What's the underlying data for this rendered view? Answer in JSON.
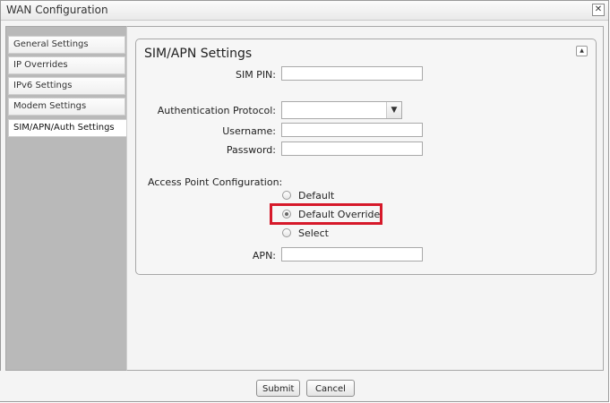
{
  "window": {
    "title": "WAN Configuration",
    "close_glyph": "✕"
  },
  "sidebar": {
    "items": [
      {
        "label": "General Settings"
      },
      {
        "label": "IP Overrides"
      },
      {
        "label": "IPv6 Settings"
      },
      {
        "label": "Modem Settings"
      },
      {
        "label": "SIM/APN/Auth Settings",
        "active": true
      }
    ]
  },
  "panel": {
    "title": "SIM/APN Settings",
    "collapse_glyph": "▲",
    "fields": {
      "sim_pin": {
        "label": "SIM PIN:",
        "value": ""
      },
      "auth_protocol": {
        "label": "Authentication Protocol:",
        "value": "",
        "arrow": "▼"
      },
      "username": {
        "label": "Username:",
        "value": ""
      },
      "password": {
        "label": "Password:",
        "value": ""
      },
      "apn": {
        "label": "APN:",
        "value": ""
      }
    },
    "access_point": {
      "label": "Access Point Configuration:",
      "options": [
        {
          "label": "Default",
          "checked": false
        },
        {
          "label": "Default Override",
          "checked": true
        },
        {
          "label": "Select",
          "checked": false
        }
      ]
    }
  },
  "buttons": {
    "submit": "Submit",
    "cancel": "Cancel"
  },
  "colors": {
    "highlight": "#d6192a",
    "sidebar_bg": "#b9b9b9"
  }
}
